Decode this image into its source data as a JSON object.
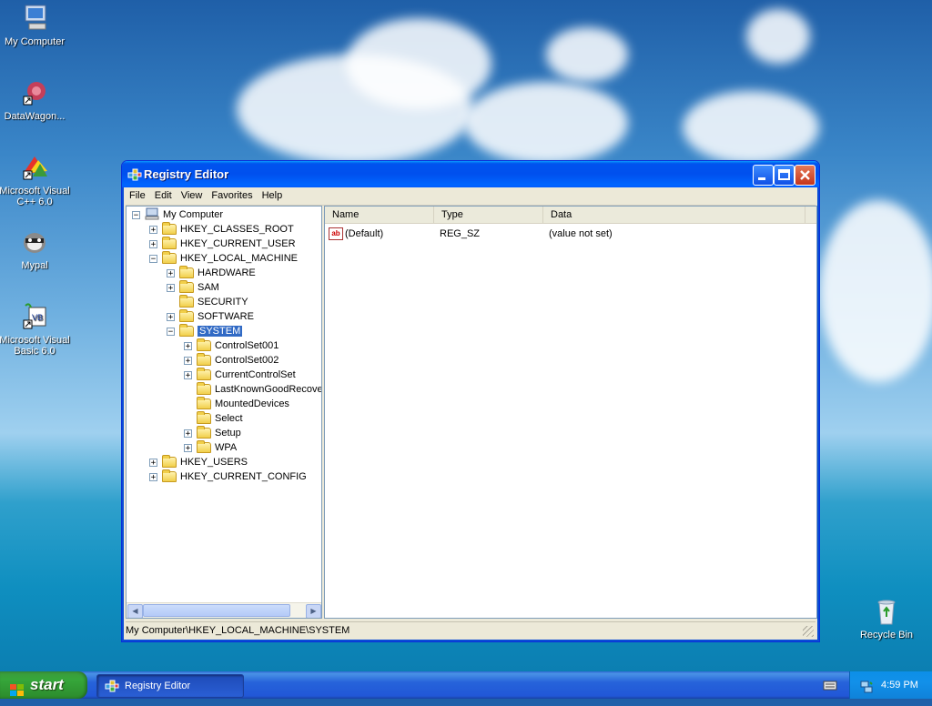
{
  "desktop": {
    "icons": [
      {
        "label": "My Computer",
        "icon": "my-computer-icon"
      },
      {
        "label": "DataWagon...",
        "icon": "datawagon-shortcut-icon"
      },
      {
        "label": "Microsoft Visual C++ 6.0",
        "icon": "visual-cpp-shortcut-icon"
      },
      {
        "label": "Mypal",
        "icon": "mypal-raccoon-icon"
      },
      {
        "label": "Microsoft Visual Basic 6.0",
        "icon": "visual-basic-shortcut-icon"
      },
      {
        "label": "Recycle Bin",
        "icon": "recycle-bin-icon"
      }
    ]
  },
  "window": {
    "title": "Registry Editor",
    "menu": [
      "File",
      "Edit",
      "View",
      "Favorites",
      "Help"
    ],
    "tree": [
      {
        "label": "My Computer",
        "expander": "−"
      },
      {
        "label": "HKEY_CLASSES_ROOT",
        "expander": "+"
      },
      {
        "label": "HKEY_CURRENT_USER",
        "expander": "+"
      },
      {
        "label": "HKEY_LOCAL_MACHINE",
        "expander": "−"
      },
      {
        "label": "HARDWARE",
        "expander": "+"
      },
      {
        "label": "SAM",
        "expander": "+"
      },
      {
        "label": "SECURITY",
        "expander": ""
      },
      {
        "label": "SOFTWARE",
        "expander": "+"
      },
      {
        "label": "SYSTEM",
        "expander": "−",
        "selected": true
      },
      {
        "label": "ControlSet001",
        "expander": "+"
      },
      {
        "label": "ControlSet002",
        "expander": "+"
      },
      {
        "label": "CurrentControlSet",
        "expander": "+"
      },
      {
        "label": "LastKnownGoodRecove",
        "expander": ""
      },
      {
        "label": "MountedDevices",
        "expander": ""
      },
      {
        "label": "Select",
        "expander": ""
      },
      {
        "label": "Setup",
        "expander": "+"
      },
      {
        "label": "WPA",
        "expander": "+"
      },
      {
        "label": "HKEY_USERS",
        "expander": "+"
      },
      {
        "label": "HKEY_CURRENT_CONFIG",
        "expander": "+"
      }
    ],
    "list": {
      "columns": [
        "Name",
        "Type",
        "Data"
      ],
      "rows": [
        {
          "name": "(Default)",
          "type": "REG_SZ",
          "data": "(value not set)",
          "icon": "string-value-icon",
          "icon_text": "ab"
        }
      ]
    },
    "status": "My Computer\\HKEY_LOCAL_MACHINE\\SYSTEM"
  },
  "taskbar": {
    "start_label": "start",
    "task": "Registry Editor",
    "clock": "4:59 PM"
  }
}
